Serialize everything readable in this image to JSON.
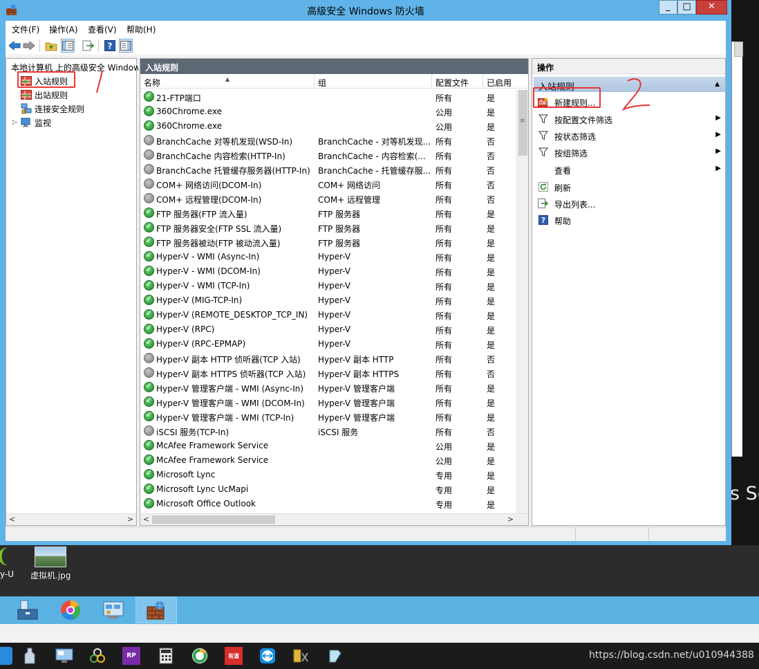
{
  "window": {
    "title": "高级安全 Windows 防火墙",
    "min": "_",
    "max": "□",
    "close": "✕"
  },
  "menu": [
    "文件(F)",
    "操作(A)",
    "查看(V)",
    "帮助(H)"
  ],
  "tree": {
    "root": "本地计算机 上的高级安全 Windows",
    "items": [
      "入站规则",
      "出站规则",
      "连接安全规则",
      "监视"
    ]
  },
  "list": {
    "header": "入站规则",
    "columns": [
      "名称",
      "组",
      "配置文件",
      "已启用"
    ],
    "rows": [
      {
        "name": "21-FTP端口",
        "group": "",
        "profile": "所有",
        "enabled": "是",
        "on": true
      },
      {
        "name": "360Chrome.exe",
        "group": "",
        "profile": "公用",
        "enabled": "是",
        "on": true
      },
      {
        "name": "360Chrome.exe",
        "group": "",
        "profile": "公用",
        "enabled": "是",
        "on": true
      },
      {
        "name": "BranchCache 对等机发现(WSD-In)",
        "group": "BranchCache - 对等机发现...",
        "profile": "所有",
        "enabled": "否",
        "on": false
      },
      {
        "name": "BranchCache 内容检索(HTTP-In)",
        "group": "BranchCache - 内容检索(...",
        "profile": "所有",
        "enabled": "否",
        "on": false
      },
      {
        "name": "BranchCache 托管缓存服务器(HTTP-In)",
        "group": "BranchCache - 托管缓存服...",
        "profile": "所有",
        "enabled": "否",
        "on": false
      },
      {
        "name": "COM+ 网络访问(DCOM-In)",
        "group": "COM+ 网络访问",
        "profile": "所有",
        "enabled": "否",
        "on": false
      },
      {
        "name": "COM+ 远程管理(DCOM-In)",
        "group": "COM+ 远程管理",
        "profile": "所有",
        "enabled": "否",
        "on": false
      },
      {
        "name": "FTP 服务器(FTP 流入量)",
        "group": "FTP 服务器",
        "profile": "所有",
        "enabled": "是",
        "on": true
      },
      {
        "name": "FTP 服务器安全(FTP SSL 流入量)",
        "group": "FTP 服务器",
        "profile": "所有",
        "enabled": "是",
        "on": true
      },
      {
        "name": "FTP 服务器被动(FTP 被动流入量)",
        "group": "FTP 服务器",
        "profile": "所有",
        "enabled": "是",
        "on": true
      },
      {
        "name": "Hyper-V - WMI (Async-In)",
        "group": "Hyper-V",
        "profile": "所有",
        "enabled": "是",
        "on": true
      },
      {
        "name": "Hyper-V - WMI (DCOM-In)",
        "group": "Hyper-V",
        "profile": "所有",
        "enabled": "是",
        "on": true
      },
      {
        "name": "Hyper-V - WMI (TCP-In)",
        "group": "Hyper-V",
        "profile": "所有",
        "enabled": "是",
        "on": true
      },
      {
        "name": "Hyper-V (MIG-TCP-In)",
        "group": "Hyper-V",
        "profile": "所有",
        "enabled": "是",
        "on": true
      },
      {
        "name": "Hyper-V (REMOTE_DESKTOP_TCP_IN)",
        "group": "Hyper-V",
        "profile": "所有",
        "enabled": "是",
        "on": true
      },
      {
        "name": "Hyper-V (RPC)",
        "group": "Hyper-V",
        "profile": "所有",
        "enabled": "是",
        "on": true
      },
      {
        "name": "Hyper-V (RPC-EPMAP)",
        "group": "Hyper-V",
        "profile": "所有",
        "enabled": "是",
        "on": true
      },
      {
        "name": "Hyper-V 副本 HTTP 侦听器(TCP 入站)",
        "group": "Hyper-V 副本 HTTP",
        "profile": "所有",
        "enabled": "否",
        "on": false
      },
      {
        "name": "Hyper-V 副本 HTTPS 侦听器(TCP 入站)",
        "group": "Hyper-V 副本 HTTPS",
        "profile": "所有",
        "enabled": "否",
        "on": false
      },
      {
        "name": "Hyper-V 管理客户端 - WMI (Async-In)",
        "group": "Hyper-V 管理客户端",
        "profile": "所有",
        "enabled": "是",
        "on": true
      },
      {
        "name": "Hyper-V 管理客户端 - WMI (DCOM-In)",
        "group": "Hyper-V 管理客户端",
        "profile": "所有",
        "enabled": "是",
        "on": true
      },
      {
        "name": "Hyper-V 管理客户端 - WMI (TCP-In)",
        "group": "Hyper-V 管理客户端",
        "profile": "所有",
        "enabled": "是",
        "on": true
      },
      {
        "name": "iSCSI 服务(TCP-In)",
        "group": "iSCSI 服务",
        "profile": "所有",
        "enabled": "否",
        "on": false
      },
      {
        "name": "McAfee Framework Service",
        "group": "",
        "profile": "公用",
        "enabled": "是",
        "on": true
      },
      {
        "name": "McAfee Framework Service",
        "group": "",
        "profile": "公用",
        "enabled": "是",
        "on": true
      },
      {
        "name": "Microsoft Lync",
        "group": "",
        "profile": "专用",
        "enabled": "是",
        "on": true
      },
      {
        "name": "Microsoft Lync UcMapi",
        "group": "",
        "profile": "专用",
        "enabled": "是",
        "on": true
      },
      {
        "name": "Microsoft Office Outlook",
        "group": "",
        "profile": "专用",
        "enabled": "是",
        "on": true
      }
    ]
  },
  "actions": {
    "header": "操作",
    "section": "入站规则",
    "items": [
      {
        "label": "新建规则...",
        "icon": "new-rule-icon",
        "submenu": false
      },
      {
        "label": "按配置文件筛选",
        "icon": "filter-icon",
        "submenu": true
      },
      {
        "label": "按状态筛选",
        "icon": "filter-icon",
        "submenu": true
      },
      {
        "label": "按组筛选",
        "icon": "filter-icon",
        "submenu": true
      },
      {
        "label": "查看",
        "icon": "",
        "submenu": true
      },
      {
        "label": "刷新",
        "icon": "refresh-icon",
        "submenu": false
      },
      {
        "label": "导出列表...",
        "icon": "export-icon",
        "submenu": false
      },
      {
        "label": "帮助",
        "icon": "help-icon",
        "submenu": false
      }
    ]
  },
  "desktop": {
    "file_label": "虚拟机.jpg",
    "partial_label": "y-U",
    "partial_text": "s Se",
    "watermark": "https://blog.csdn.net/u010944388"
  },
  "annotations": {
    "mark1": "1",
    "mark2": "2",
    "color": "#e33333"
  }
}
